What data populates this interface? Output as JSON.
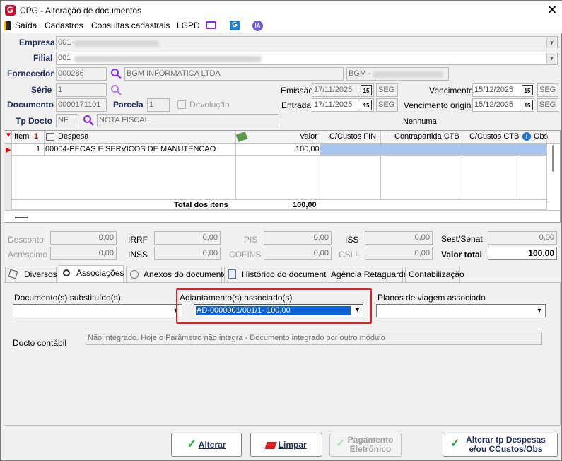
{
  "window": {
    "title": "CPG - Alteração de documentos",
    "close": "✕"
  },
  "menu": {
    "saida": "Saída",
    "cadastros": "Cadastros",
    "consultas": "Consultas cadastrais",
    "lgpd": "LGPD",
    "ia": "IA"
  },
  "form": {
    "empresa_label": "Empresa",
    "empresa_value": "001",
    "filial_label": "Filial",
    "filial_value": "001",
    "fornecedor_label": "Fornecedor",
    "fornecedor_code": "000286",
    "fornecedor_name": "BGM INFORMATICA LTDA",
    "fornecedor_short": "BGM -",
    "serie_label": "Série",
    "serie_value": "1",
    "documento_label": "Documento",
    "documento_value": "0000171101",
    "parcela_label": "Parcela",
    "parcela_value": "1",
    "devolucao_label": "Devolução",
    "tpdocto_label": "Tp Docto",
    "tpdocto_code": "NF",
    "tpdocto_name": "NOTA FISCAL",
    "emissao_label": "Emissão",
    "emissao_value": "17/11/2025",
    "emissao_day": "SEG",
    "entrada_label": "Entrada",
    "entrada_value": "17/11/2025",
    "entrada_day": "SEG",
    "vencimento_label": "Vencimento",
    "vencimento_value": "15/12/2025",
    "vencimento_day": "SEG",
    "venc_orig_label": "Vencimento original",
    "venc_orig_value": "15/12/2025",
    "venc_orig_day": "SEG",
    "nenhuma": "Nenhuma",
    "cal_icon": "15"
  },
  "grid": {
    "headers": {
      "item": "Item",
      "sort": "1",
      "despesa": "Despesa",
      "valor": "Valor",
      "ccfin": "C/Custos FIN",
      "contrapartida": "Contrapartida CTB",
      "ccctb": "C/Custos CTB",
      "obs": "Obs"
    },
    "rows": [
      {
        "item": "1",
        "despesa": "00004-PECAS E SERVICOS DE MANUTENCAO",
        "valor": "100,00"
      }
    ],
    "total_label": "Total dos itens",
    "total_value": "100,00"
  },
  "totals": {
    "desconto_label": "Desconto",
    "desconto_value": "0,00",
    "acrescimo_label": "Acréscimo",
    "acrescimo_value": "0,00",
    "irrf_label": "IRRF",
    "irrf_value": "0,00",
    "inss_label": "INSS",
    "inss_value": "0,00",
    "pis_label": "PIS",
    "pis_value": "0,00",
    "cofins_label": "COFINS",
    "cofins_value": "0,00",
    "iss_label": "ISS",
    "iss_value": "0,00",
    "csll_label": "CSLL",
    "csll_value": "0,00",
    "sest_label": "Sest/Senat",
    "sest_value": "0,00",
    "valortotal_label": "Valor total",
    "valortotal_value": "100,00"
  },
  "tabs": [
    "Diversos",
    "Associações",
    "Anexos do documento",
    "Histórico do documento",
    "Agência Retaguarda",
    "Contabilização"
  ],
  "assoc": {
    "docsub_label": "Documento(s) substituído(s)",
    "adiant_label": "Adiantamento(s) associado(s)",
    "adiant_value": "AD-0000001/001/1-         100,00",
    "planos_label": "Planos de viagem associado",
    "docto_contabil_label": "Docto contábil",
    "docto_contabil_value": "Não integrado. Hoje o Parâmetro não integra - Documento integrado por outro módulo"
  },
  "buttons": {
    "alterar": "Alterar",
    "limpar": "Limpar",
    "pagamento_1": "Pagamento",
    "pagamento_2": "Eletrônico",
    "alterar_tp_1": "Alterar tp Despesas",
    "alterar_tp_2": "e/ou CCustos/Obs"
  },
  "colors": {
    "accent_red": "#c8102e",
    "selection_blue": "#0a64d8",
    "highlight_box": "#e02020",
    "check_green": "#1faa3a"
  }
}
